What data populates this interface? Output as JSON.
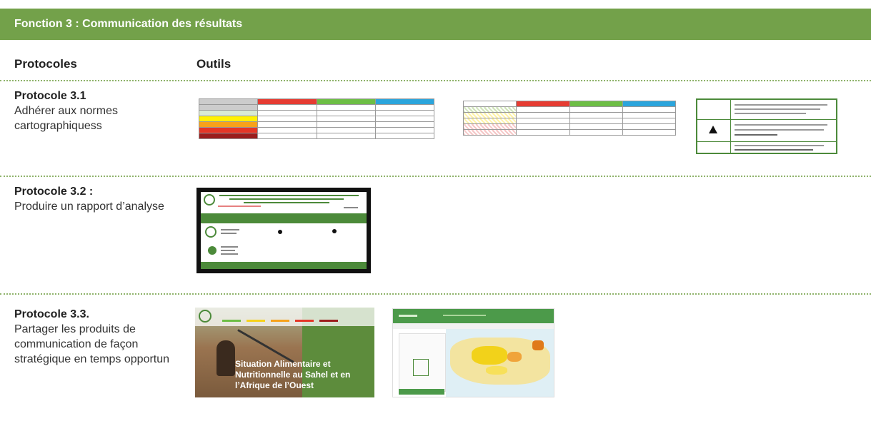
{
  "banner": {
    "title": "Fonction 3 : Communication des résultats"
  },
  "columns": {
    "protocols": "Protocoles",
    "tools": "Outils"
  },
  "protocols": [
    {
      "title": "Protocole 3.1",
      "text": "Adhérer aux normes cartographiquess"
    },
    {
      "title": "Protocole 3.2 :",
      "text": "Produire un rapport d’analyse"
    },
    {
      "title": "Protocole 3.3.",
      "text": "Partager les produits de communication de façon stratégique en temps opportun"
    }
  ],
  "thumb_text": {
    "map_title": "Situation Alimentaire et Nutritionnelle au Sahel et en l’Afrique de l’Ouest"
  },
  "colors": {
    "banner": "#73a14a",
    "dots": "#8fb36b",
    "dark_green": "#4c8a3a"
  }
}
